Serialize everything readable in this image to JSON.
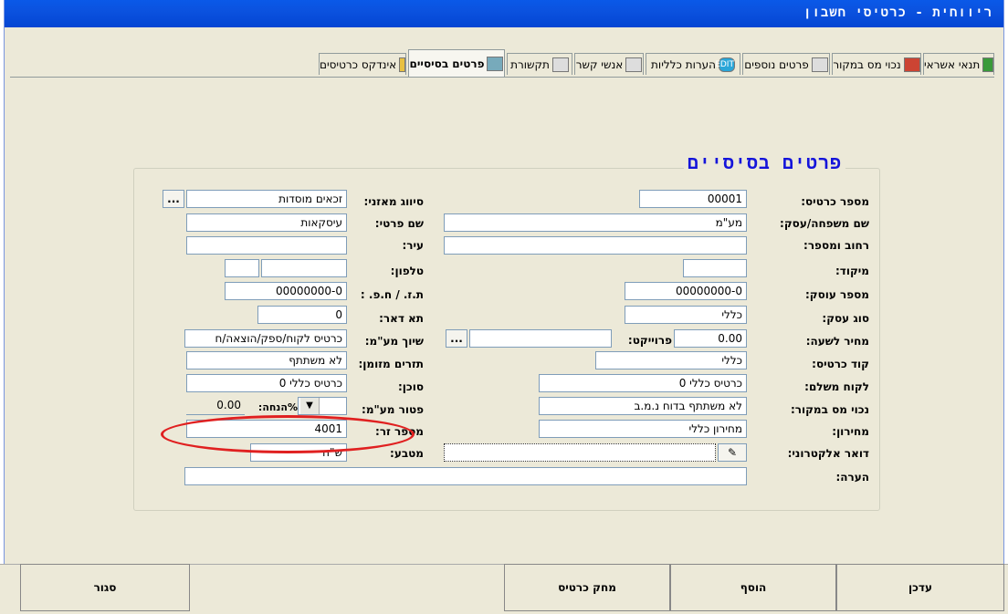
{
  "window": {
    "title": "ריווחית - כרטיסי חשבון"
  },
  "tabs": [
    {
      "label": "תנאי אשראי",
      "icon": "money-bag-icon"
    },
    {
      "label": "נכוי מס במקור",
      "icon": "pen-icon"
    },
    {
      "label": "פרטים נוספים",
      "icon": "folder-icon"
    },
    {
      "label": "הערות כלליות",
      "icon": "edit-icon",
      "badge": "EDIT"
    },
    {
      "label": "אנשי קשר",
      "icon": "person-icon"
    },
    {
      "label": "תקשורת",
      "icon": "phone-icon"
    },
    {
      "label": "פרטים בסיסיים",
      "icon": "card-icon"
    },
    {
      "label": "אינדקס כרטיסים",
      "icon": "sparkle-icon"
    }
  ],
  "group": {
    "title": "פרטים בסיסיים"
  },
  "right_fields": {
    "card_number": {
      "label": "מספר כרטיס:",
      "value": "00001"
    },
    "family_name": {
      "label": "שם משפחה/עסק:",
      "value": "מע\"מ"
    },
    "street": {
      "label": "רחוב ומספר:",
      "value": ""
    },
    "zip": {
      "label": "מיקוד:",
      "value": ""
    },
    "business_number": {
      "label": "מספר עוסק:",
      "value": "00000000-0"
    },
    "business_type": {
      "label": "סוג עסק:",
      "value": "כללי"
    },
    "hourly_price": {
      "label": "מחיר לשעה:",
      "value": "0.00"
    },
    "project": {
      "label": "פרוייקט:",
      "value": ""
    },
    "card_code": {
      "label": "קוד כרטיס:",
      "value": "כללי"
    },
    "paying_customer": {
      "label": "לקוח משלם:",
      "value": "כרטיס כללי 0"
    },
    "tax_deduction": {
      "label": "נכוי מס במקור:",
      "value": "לא משתתף בדוח נ.מ.ב"
    },
    "price_list": {
      "label": "מחירון:",
      "value": "מחירון כללי"
    },
    "email": {
      "label": "דואר אלקטרוני:",
      "value": ""
    },
    "note": {
      "label": "הערה:",
      "value": ""
    }
  },
  "left_fields": {
    "ledger_class": {
      "label": "סיווג מאזני:",
      "value": "זכאים מוסדות"
    },
    "first_name": {
      "label": "שם פרטי:",
      "value": "עיסקאות"
    },
    "city": {
      "label": "עיר:",
      "value": ""
    },
    "phone": {
      "label": "טלפון:",
      "value": "",
      "value2": ""
    },
    "id_number": {
      "label": "ת.ז. / ח.פ. :",
      "value": "00000000-0"
    },
    "po_box": {
      "label": "תא דאר:",
      "value": "0"
    },
    "vat_assign": {
      "label": "שיוך מע\"מ:",
      "value": "כרטיס לקוח/ספק/הוצאה/ח"
    },
    "cash_flow": {
      "label": "תזרים מזומן:",
      "value": "לא משתתף"
    },
    "agent": {
      "label": "סוכן:",
      "value": "כרטיס כללי 0"
    },
    "vat_exempt": {
      "label": "פטור מע\"מ:",
      "discount_label": "%הנחה:",
      "discount_value": "0.00"
    },
    "foreign_number": {
      "label": "מספר זר:",
      "value": "4001"
    },
    "currency": {
      "label": "מטבע:",
      "value": "ש\"ח"
    }
  },
  "buttons": {
    "update": "עדכן",
    "add": "הוסף",
    "delete_card": "מחק כרטיס",
    "close": "סגור",
    "ellipsis": "..."
  }
}
